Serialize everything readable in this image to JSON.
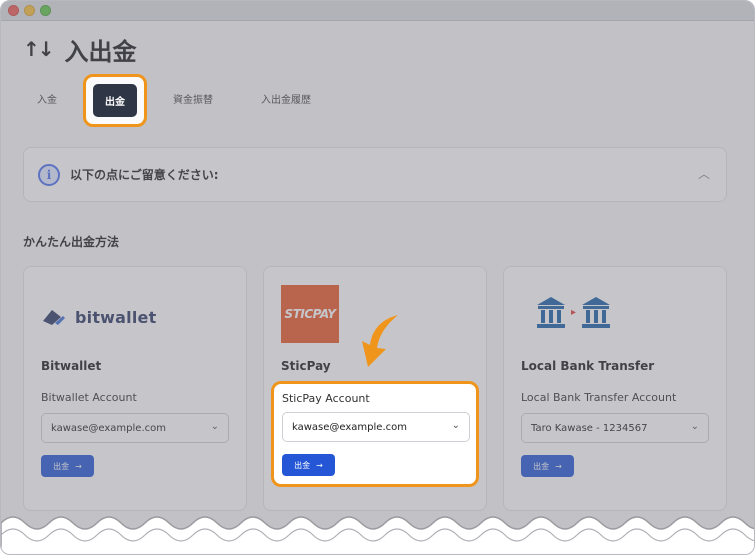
{
  "page": {
    "title": "入出金",
    "title_icon": "arrows-up-down-icon"
  },
  "tabs": [
    {
      "label": "入金",
      "active": false
    },
    {
      "label": "出金",
      "active": true
    },
    {
      "label": "資金振替",
      "active": false
    },
    {
      "label": "入出金履歴",
      "active": false
    }
  ],
  "notice": {
    "text": "以下の点にご留意ください:",
    "icon": "info-icon"
  },
  "section": {
    "title": "かんたん出金方法"
  },
  "methods": [
    {
      "logo_text": "bitwallet",
      "name": "Bitwallet",
      "account_label": "Bitwallet Account",
      "selected": "kawase@example.com",
      "button_label": "出金"
    },
    {
      "logo_text": "STICPAY",
      "name": "SticPay",
      "account_label": "SticPay Account",
      "selected": "kawase@example.com",
      "button_label": "出金"
    },
    {
      "name": "Local Bank Transfer",
      "account_label": "Local Bank Transfer Account",
      "selected": "Taro Kawase - 1234567",
      "button_label": "出金"
    }
  ],
  "colors": {
    "accent_highlight": "#f0951b",
    "primary_button": "#2456d6",
    "active_tab": "#2f3645",
    "bank_icon": "#1a5fa8",
    "sticpay_brand": "#e8582a"
  }
}
